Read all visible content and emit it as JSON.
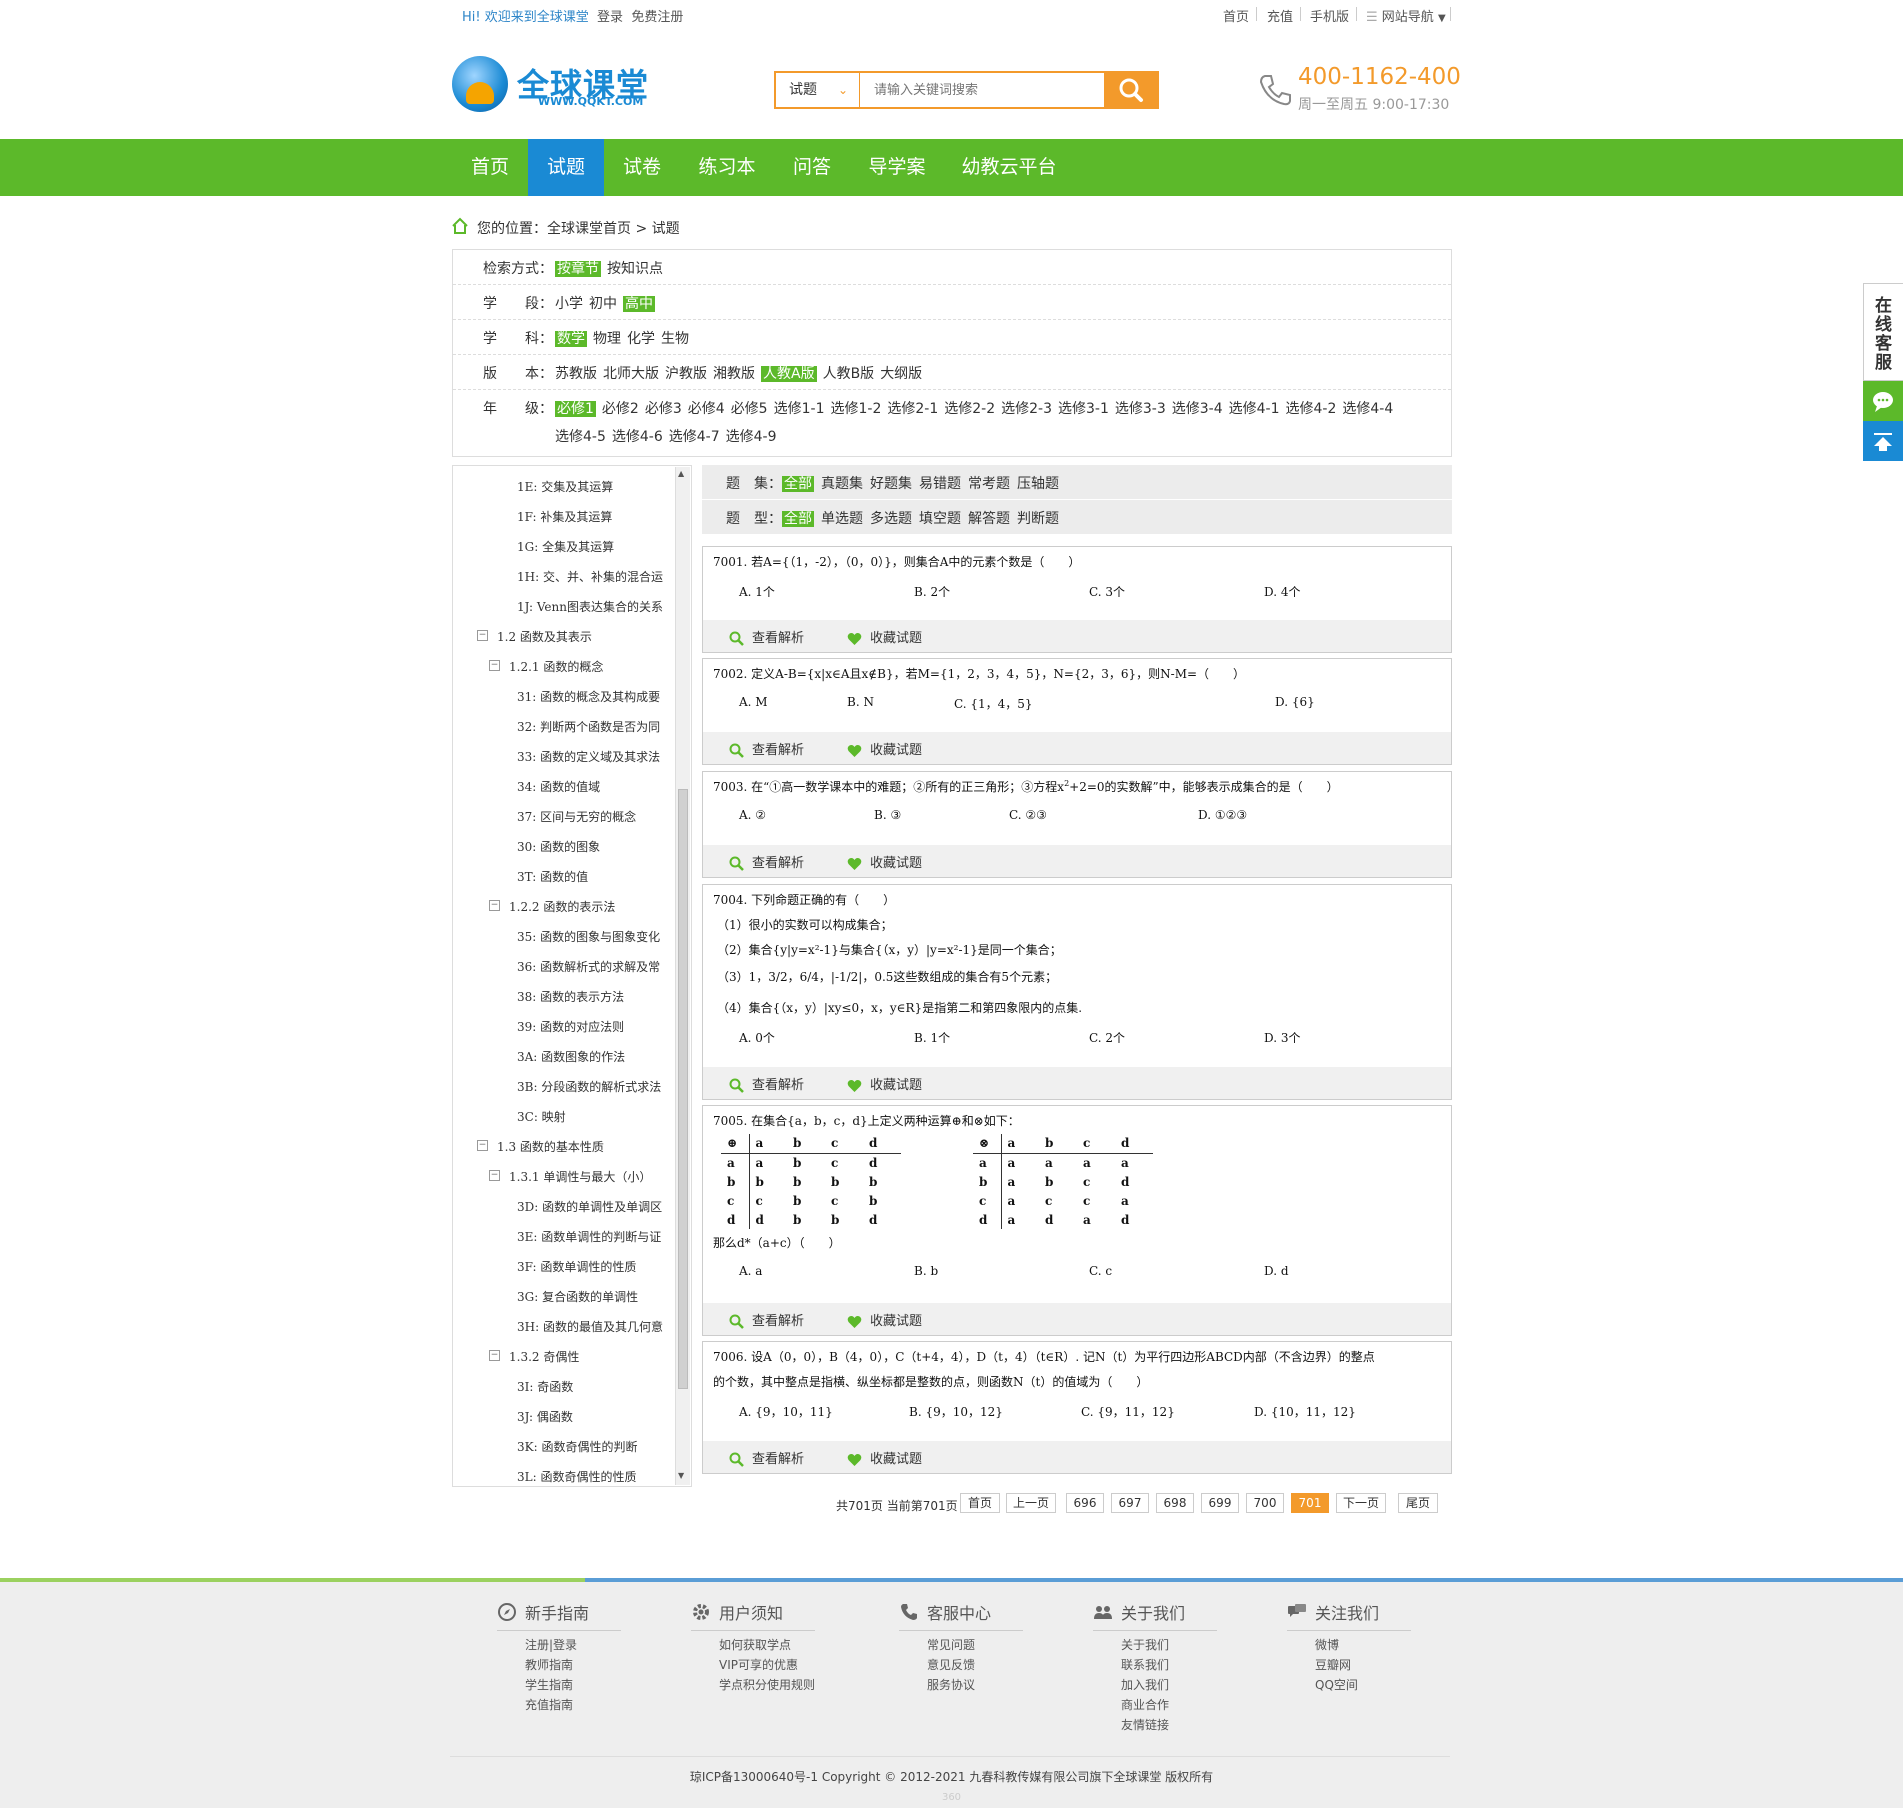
{
  "topbar": {
    "greet_hi": "Hi!",
    "greet_text": "欢迎来到全球课堂",
    "login": "登录",
    "register": "免费注册",
    "links": [
      "首页",
      "充值",
      "手机版"
    ],
    "site_nav": "网站导航"
  },
  "header": {
    "logo_text": "全球课堂",
    "logo_url": "WWW.QQKT.COM",
    "search_type": "试题",
    "search_placeholder": "请输入关键词搜索",
    "phone": "400-1162-400",
    "hours": "周一至周五 9:00-17:30"
  },
  "nav": {
    "items": [
      "首页",
      "试题",
      "试卷",
      "练习本",
      "问答",
      "导学案",
      "幼教云平台"
    ],
    "active_index": 1
  },
  "breadcrumb": "您的位置：全球课堂首页 > 试题",
  "filters": [
    {
      "label": "检索方式：",
      "options": [
        "按章节",
        "按知识点"
      ],
      "selected": 0
    },
    {
      "label": "学　　段：",
      "options": [
        "小学",
        "初中",
        "高中"
      ],
      "selected": 2
    },
    {
      "label": "学　　科：",
      "options": [
        "数学",
        "物理",
        "化学",
        "生物"
      ],
      "selected": 0
    },
    {
      "label": "版　　本：",
      "options": [
        "苏教版",
        "北师大版",
        "沪教版",
        "湘教版",
        "人教A版",
        "人教B版",
        "大纲版"
      ],
      "selected": 4
    },
    {
      "label": "年　　级：",
      "options": [
        "必修1",
        "必修2",
        "必修3",
        "必修4",
        "必修5",
        "选修1-1",
        "选修1-2",
        "选修2-1",
        "选修2-2",
        "选修2-3",
        "选修3-1",
        "选修3-3",
        "选修3-4",
        "选修4-1",
        "选修4-2",
        "选修4-4"
      ],
      "options_row2": [
        "选修4-5",
        "选修4-6",
        "选修4-7",
        "选修4-9"
      ],
      "selected": 0
    }
  ],
  "tree": [
    {
      "text": "1E: 交集及其运算",
      "level": 3
    },
    {
      "text": "1F: 补集及其运算",
      "level": 3
    },
    {
      "text": "1G: 全集及其运算",
      "level": 3
    },
    {
      "text": "1H: 交、并、补集的混合运",
      "level": 3
    },
    {
      "text": "1J: Venn图表达集合的关系",
      "level": 3
    },
    {
      "text": "1.2 函数及其表示",
      "level": 1,
      "toggle": "−"
    },
    {
      "text": "1.2.1 函数的概念",
      "level": 2,
      "toggle": "−"
    },
    {
      "text": "31: 函数的概念及其构成要",
      "level": 3
    },
    {
      "text": "32: 判断两个函数是否为同",
      "level": 3
    },
    {
      "text": "33: 函数的定义域及其求法",
      "level": 3
    },
    {
      "text": "34: 函数的值域",
      "level": 3
    },
    {
      "text": "37: 区间与无穷的概念",
      "level": 3
    },
    {
      "text": "30: 函数的图象",
      "level": 3
    },
    {
      "text": "3T: 函数的值",
      "level": 3
    },
    {
      "text": "1.2.2 函数的表示法",
      "level": 2,
      "toggle": "−"
    },
    {
      "text": "35: 函数的图象与图象变化",
      "level": 3
    },
    {
      "text": "36: 函数解析式的求解及常",
      "level": 3
    },
    {
      "text": "38: 函数的表示方法",
      "level": 3
    },
    {
      "text": "39: 函数的对应法则",
      "level": 3
    },
    {
      "text": "3A: 函数图象的作法",
      "level": 3
    },
    {
      "text": "3B: 分段函数的解析式求法",
      "level": 3
    },
    {
      "text": "3C: 映射",
      "level": 3
    },
    {
      "text": "1.3 函数的基本性质",
      "level": 1,
      "toggle": "−"
    },
    {
      "text": "1.3.1 单调性与最大（小）",
      "level": 2,
      "toggle": "−"
    },
    {
      "text": "3D: 函数的单调性及单调区",
      "level": 3
    },
    {
      "text": "3E: 函数单调性的判断与证",
      "level": 3
    },
    {
      "text": "3F: 函数单调性的性质",
      "level": 3
    },
    {
      "text": "3G: 复合函数的单调性",
      "level": 3
    },
    {
      "text": "3H: 函数的最值及其几何意",
      "level": 3
    },
    {
      "text": "1.3.2 奇偶性",
      "level": 2,
      "toggle": "−"
    },
    {
      "text": "3I: 奇函数",
      "level": 3
    },
    {
      "text": "3J: 偶函数",
      "level": 3
    },
    {
      "text": "3K: 函数奇偶性的判断",
      "level": 3
    },
    {
      "text": "3L: 函数奇偶性的性质",
      "level": 3
    }
  ],
  "qfilter": [
    {
      "label": "题　集：",
      "options": [
        "全部",
        "真题集",
        "好题集",
        "易错题",
        "常考题",
        "压轴题"
      ],
      "selected": 0
    },
    {
      "label": "题　型：",
      "options": [
        "全部",
        "单选题",
        "多选题",
        "填空题",
        "解答题",
        "判断题"
      ],
      "selected": 0
    }
  ],
  "actions": {
    "view": "查看解析",
    "fav": "收藏试题"
  },
  "questions": [
    {
      "stem": "7001. 若A={（1，-2），（0，0）}，则集合A中的元素个数是（　　）",
      "options": [
        "A. 1个",
        "B. 2个",
        "C. 3个",
        "D. 4个"
      ]
    },
    {
      "stem": "7002. 定义A-B={x|x∈A且x∉B}，若M={1，2，3，4，5}，N={2，3，6}，则N-M=（　　）",
      "options": [
        "A. M",
        "B. N",
        "C. {1，4，5}",
        "D. {6}"
      ]
    },
    {
      "stem_a": "7003. 在“①高一数学课本中的难题；②所有的正三角形；③方程x",
      "stem_sup": "2",
      "stem_b": "+2=0的实数解”中，能够表示成集合的是（　　）",
      "options": [
        "A. ②",
        "B. ③",
        "C. ②③",
        "D. ①②③"
      ]
    },
    {
      "stem": "7004. 下列命题正确的有（　　）",
      "lines": [
        "（1）很小的实数可以构成集合；",
        "（2）集合{y|y=x²-1}与集合{（x，y）|y=x²-1}是同一个集合；",
        "（3）1，3/2，6/4，|-1/2|，0.5这些数组成的集合有5个元素；",
        "（4）集合{（x，y）|xy≤0，x，y∈R}是指第二和第四象限内的点集."
      ],
      "options": [
        "A. 0个",
        "B. 1个",
        "C. 2个",
        "D. 3个"
      ]
    },
    {
      "stem": "7005. 在集合{a，b，c，d}上定义两种运算⊕和⊗如下：",
      "table1": {
        "op": "⊕",
        "rows": [
          [
            "a",
            "b",
            "c",
            "d"
          ],
          [
            "a",
            "a",
            "b",
            "c",
            "d"
          ],
          [
            "b",
            "b",
            "b",
            "b",
            "b"
          ],
          [
            "c",
            "c",
            "b",
            "c",
            "b"
          ],
          [
            "d",
            "d",
            "b",
            "b",
            "d"
          ]
        ]
      },
      "table2": {
        "op": "⊗",
        "rows": [
          [
            "a",
            "b",
            "c",
            "d"
          ],
          [
            "a",
            "a",
            "a",
            "a",
            "a"
          ],
          [
            "b",
            "a",
            "b",
            "c",
            "d"
          ],
          [
            "c",
            "a",
            "c",
            "c",
            "a"
          ],
          [
            "d",
            "a",
            "d",
            "a",
            "d"
          ]
        ]
      },
      "tail": "那么d*（a+c）（　　）",
      "options": [
        "A. a",
        "B. b",
        "C. c",
        "D. d"
      ]
    },
    {
      "stem": "7006. 设A（0，0），B（4，0），C（t+4，4），D（t，4）（t∈R）. 记N（t）为平行四边形ABCD内部（不含边界）的整点",
      "stem2": "的个数，其中整点是指横、纵坐标都是整数的点，则函数N（t）的值域为（　　）",
      "options": [
        "A. {9，10，11}",
        "B. {9，10，12}",
        "C. {9，11，12}",
        "D. {10，11，12}"
      ]
    }
  ],
  "pager": {
    "info": "共701页 当前第701页",
    "first": "首页",
    "prev": "上一页",
    "pages": [
      "696",
      "697",
      "698",
      "699",
      "700",
      "701"
    ],
    "current": "701",
    "next": "下一页",
    "last": "尾页"
  },
  "side": {
    "kefu": "在线客服"
  },
  "footer": {
    "cols": [
      {
        "title": "新手指南",
        "icon": "compass-icon",
        "links": [
          "注册|登录",
          "教师指南",
          "学生指南",
          "充值指南"
        ]
      },
      {
        "title": "用户须知",
        "icon": "gear-icon",
        "links": [
          "如何获取学点",
          "VIP可享的优惠",
          "学点积分使用规则"
        ]
      },
      {
        "title": "客服中心",
        "icon": "phone-icon",
        "links": [
          "常见问题",
          "意见反馈",
          "服务协议"
        ]
      },
      {
        "title": "关于我们",
        "icon": "people-icon",
        "links": [
          "关于我们",
          "联系我们",
          "加入我们",
          "商业合作",
          "友情链接"
        ]
      },
      {
        "title": "关注我们",
        "icon": "chat-icon",
        "links": [
          "微博",
          "豆瓣网",
          "QQ空间"
        ]
      }
    ],
    "copyright": "琼ICP备13000640号-1 Copyright © 2012-2021 九春科教传媒有限公司旗下全球课堂 版权所有",
    "badge": "360"
  },
  "colors": {
    "green": "#5cb92a",
    "blue": "#1a8ad4",
    "orange": "#f39a2b"
  }
}
